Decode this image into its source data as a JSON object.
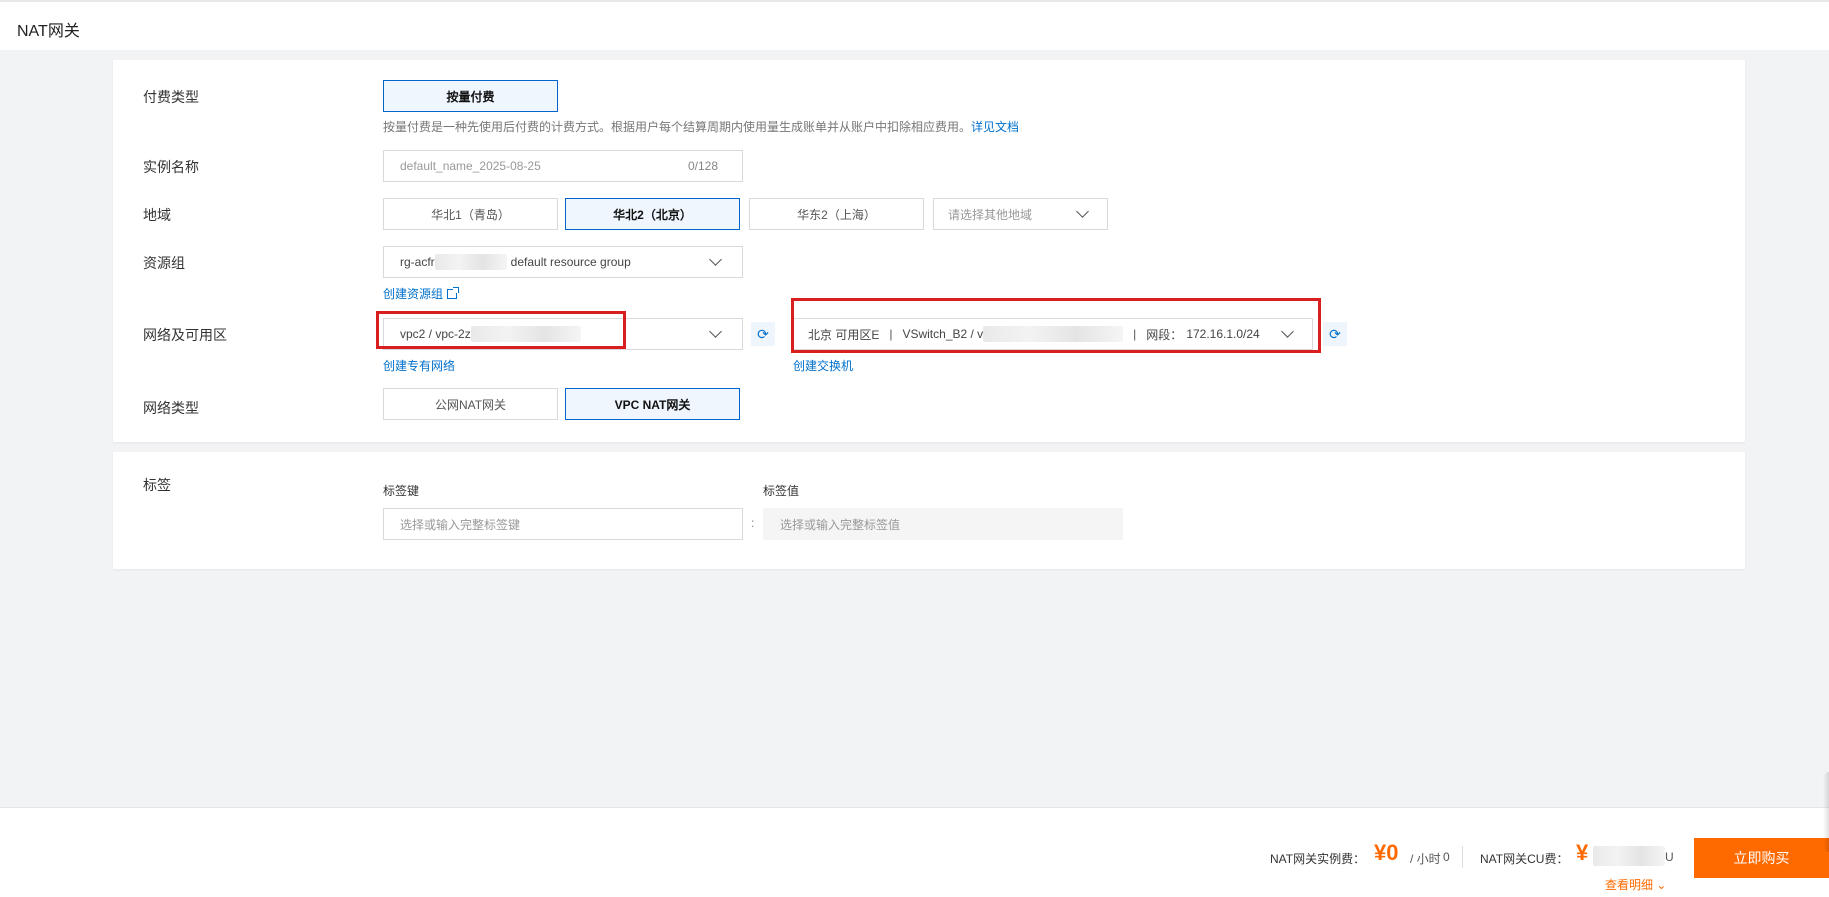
{
  "page": {
    "title": "NAT网关"
  },
  "billing": {
    "label": "付费类型",
    "option": "按量付费",
    "description": "按量付费是一种先使用后付费的计费方式。根据用户每个结算周期内使用量生成账单并从账户中扣除相应费用。",
    "doc_link": "详见文档"
  },
  "instance_name": {
    "label": "实例名称",
    "placeholder": "default_name_2025-08-25",
    "counter": "0/128"
  },
  "region": {
    "label": "地域",
    "options": [
      "华北1（青岛）",
      "华北2（北京）",
      "华东2（上海）"
    ],
    "selected": "华北2（北京）",
    "other_placeholder": "请选择其他地域"
  },
  "resource_group": {
    "label": "资源组",
    "value_prefix": "rg-acfr",
    "value_suffix": "default resource group",
    "create_link": "创建资源组"
  },
  "network": {
    "label": "网络及可用区",
    "vpc_value": "vpc2 / vpc-2z",
    "create_vpc_link": "创建专有网络",
    "vswitch_zone": "北京 可用区E",
    "vswitch_name": "VSwitch_B2 / v",
    "vswitch_cidr_label": "网段：",
    "vswitch_cidr": "172.16.1.0/24",
    "create_vswitch_link": "创建交换机"
  },
  "network_type": {
    "label": "网络类型",
    "options": [
      "公网NAT网关",
      "VPC NAT网关"
    ],
    "selected": "VPC NAT网关"
  },
  "tags": {
    "label": "标签",
    "key_label": "标签键",
    "value_label": "标签值",
    "key_placeholder": "选择或输入完整标签键",
    "value_placeholder": "选择或输入完整标签值",
    "separator": ":"
  },
  "footer": {
    "instance_fee_label": "NAT网关实例费：",
    "instance_fee_price": "¥0",
    "instance_fee_unit": "/ 小时",
    "cu_fee_label": "NAT网关CU费：",
    "cu_fee_price": "¥",
    "detail_link": "查看明细",
    "buy_button": "立即购买"
  },
  "colors": {
    "accent": "#0064c8",
    "link": "#0070cc",
    "price": "#ff6a00",
    "highlight": "#d81e1e"
  }
}
